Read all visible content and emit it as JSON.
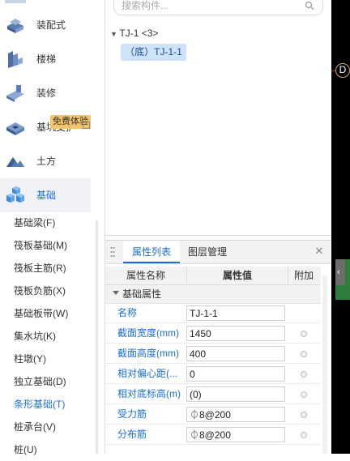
{
  "categories": [
    {
      "label": "装配式",
      "icon": "prefab-icon"
    },
    {
      "label": "楼梯",
      "icon": "stairs-icon"
    },
    {
      "label": "装修",
      "icon": "decoration-icon"
    },
    {
      "label": "基坑支护",
      "icon": "foundation-pit-icon"
    },
    {
      "label": "土方",
      "icon": "earthwork-icon"
    },
    {
      "label": "基础",
      "icon": "foundation-icon"
    }
  ],
  "badge": "免费体验",
  "subitems": [
    "基础梁(F)",
    "筏板基础(M)",
    "筏板主筋(R)",
    "筏板负筋(X)",
    "基础板带(W)",
    "集水坑(K)",
    "柱墩(Y)",
    "独立基础(D)",
    "条形基础(T)",
    "桩承台(V)",
    "桩(U)"
  ],
  "search": {
    "placeholder": "搜索构件..."
  },
  "tree": {
    "root": "TJ-1 <3>",
    "child": "（底）TJ-1-1"
  },
  "tabs": {
    "properties": "属性列表",
    "layers": "图层管理"
  },
  "table": {
    "headers": {
      "name": "属性名称",
      "value": "属性值",
      "extra": "附加"
    },
    "group": "基础属性",
    "rows": [
      {
        "name": "名称",
        "value": "TJ-1-1",
        "has_check": false
      },
      {
        "name": "截面宽度(mm)",
        "value": "1450",
        "has_check": true
      },
      {
        "name": "截面高度(mm)",
        "value": "400",
        "has_check": true
      },
      {
        "name": "相对偏心距(...",
        "value": "0",
        "has_check": true
      },
      {
        "name": "相对底标高(m)",
        "value": "(0)",
        "has_check": true
      },
      {
        "name": "受力筋",
        "value": "⏀8@200",
        "has_check": true
      },
      {
        "name": "分布筋",
        "value": "⏀8@200",
        "has_check": true
      }
    ]
  },
  "canvas": {
    "axis_label": "D"
  },
  "colors": {
    "accent": "#1a6fd1",
    "selected": "#cfe3f8",
    "badge": "#f4c46a"
  }
}
